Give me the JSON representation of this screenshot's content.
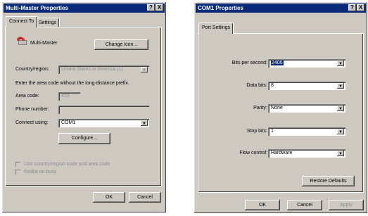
{
  "left": {
    "title": "Multi-Master Properties",
    "help": "?",
    "close": "X",
    "tabs": [
      "Connect To",
      "Settings"
    ],
    "connection_name": "Multi-Master",
    "change_icon": "Change Icon...",
    "country_label": "Country/region:",
    "country_value": "United States of America (1)",
    "area_hint": "Enter the area code without the long-distance prefix.",
    "area_label": "Area code:",
    "area_value": "423",
    "phone_label": "Phone number:",
    "phone_value": "",
    "connect_label": "Connect using:",
    "connect_value": "COM1",
    "configure": "Configure...",
    "use_country": "Use country/region code and area code",
    "redial": "Redial on busy",
    "ok": "OK",
    "cancel": "Cancel"
  },
  "right": {
    "title": "COM1 Properties",
    "help": "?",
    "close": "X",
    "tab": "Port Settings",
    "bits_label": "Bits per second:",
    "bits_value": "2400",
    "data_label": "Data bits:",
    "data_value": "8",
    "parity_label": "Parity:",
    "parity_value": "None",
    "stop_label": "Stop bits:",
    "stop_value": "1",
    "flow_label": "Flow control:",
    "flow_value": "Hardware",
    "restore": "Restore Defaults",
    "ok": "OK",
    "cancel": "Cancel",
    "apply": "Apply"
  },
  "dropdown_glyph": "▼",
  "colors": {
    "titlebar": "#082a78",
    "face": "#cdc8c0",
    "disabled_text": "#8c8c8c"
  }
}
